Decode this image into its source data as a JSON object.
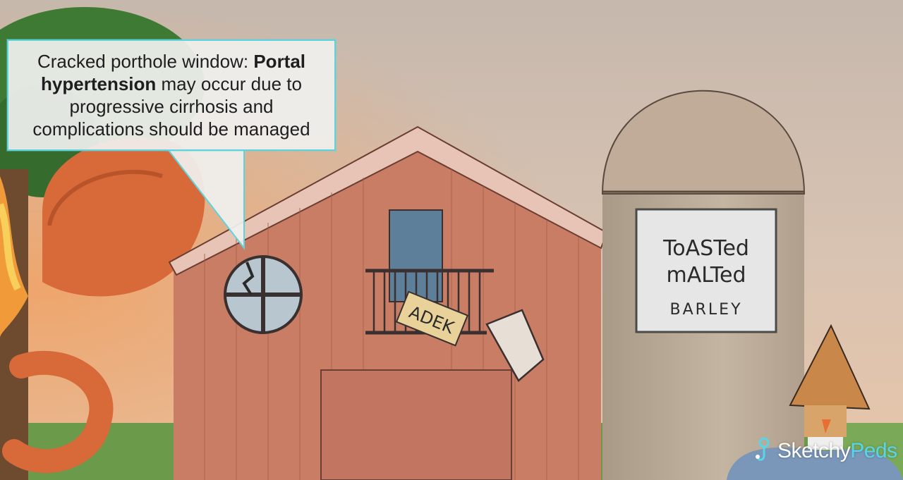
{
  "callout": {
    "part1": "Cracked porthole window: ",
    "bold": "Portal hypertension",
    "part2": " may occur due to progressive cirrhosis and complications should be managed"
  },
  "sign": {
    "line1": "ToASTed",
    "line2": "mALTed",
    "line3": "BARLEY"
  },
  "balcony_sign": "ADEK",
  "logo": {
    "part1": "Sketchy",
    "part2": "Peds"
  },
  "colors": {
    "sky": "#d4c2b3",
    "barn": "#c97d65",
    "roof_trim": "#e8c4b6",
    "silo": "#b9a997",
    "accent": "#5fd3dd",
    "grass": "#6b9a4a"
  }
}
